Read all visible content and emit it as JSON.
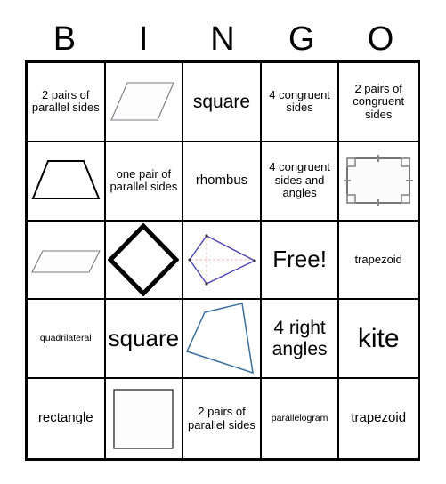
{
  "header": {
    "letters": [
      "B",
      "I",
      "N",
      "G",
      "O"
    ]
  },
  "grid": {
    "rows": [
      [
        {
          "type": "text",
          "text": "2 pairs of parallel sides",
          "size": "fs-s"
        },
        {
          "type": "shape",
          "shape": "parallelogram-grey-right",
          "label": "parallelogram-shape"
        },
        {
          "type": "text",
          "text": "square",
          "size": "fs-l"
        },
        {
          "type": "text",
          "text": "4 congruent sides",
          "size": "fs-s"
        },
        {
          "type": "text",
          "text": "2 pairs of congruent sides",
          "size": "fs-s"
        }
      ],
      [
        {
          "type": "shape",
          "shape": "trapezoid-black",
          "label": "trapezoid-shape"
        },
        {
          "type": "text",
          "text": "one pair of parallel sides",
          "size": "fs-s"
        },
        {
          "type": "text",
          "text": "rhombus",
          "size": "fs-m"
        },
        {
          "type": "text",
          "text": "4 congruent sides and angles",
          "size": "fs-s"
        },
        {
          "type": "shape",
          "shape": "square-marked",
          "label": "marked-square-shape"
        }
      ],
      [
        {
          "type": "shape",
          "shape": "parallelogram-flat-grey",
          "label": "flat-parallelogram-shape"
        },
        {
          "type": "shape",
          "shape": "rhombus-bold-black",
          "label": "rhombus-shape"
        },
        {
          "type": "shape",
          "shape": "kite-blue-diagonals",
          "label": "kite-shape"
        },
        {
          "type": "text",
          "text": "Free!",
          "size": "fs-xl"
        },
        {
          "type": "text",
          "text": "trapezoid",
          "size": "fs-s"
        }
      ],
      [
        {
          "type": "text",
          "text": "quadrilateral",
          "size": "fs-xs"
        },
        {
          "type": "text",
          "text": "square",
          "size": "fs-xl"
        },
        {
          "type": "shape",
          "shape": "quadrilateral-blue",
          "label": "irregular-quadrilateral-shape"
        },
        {
          "type": "text",
          "text": "4 right angles",
          "size": "fs-l"
        },
        {
          "type": "text",
          "text": "kite",
          "size": "fs-xxl"
        }
      ],
      [
        {
          "type": "text",
          "text": "rectangle",
          "size": "fs-m"
        },
        {
          "type": "shape",
          "shape": "square-plain",
          "label": "plain-square-shape"
        },
        {
          "type": "text",
          "text": "2 pairs of parallel sides",
          "size": "fs-s"
        },
        {
          "type": "text",
          "text": "parallelogram",
          "size": "fs-xs"
        },
        {
          "type": "text",
          "text": "trapezoid",
          "size": "fs-m"
        }
      ]
    ]
  },
  "colors": {
    "border": "#000000",
    "text": "#000000",
    "shape_grey": "#7a7a80",
    "shape_black": "#000000",
    "shape_blue": "#3d6f9e",
    "shape_purple": "#4a43b4",
    "diagonal_pink": "#f2b8b8"
  }
}
